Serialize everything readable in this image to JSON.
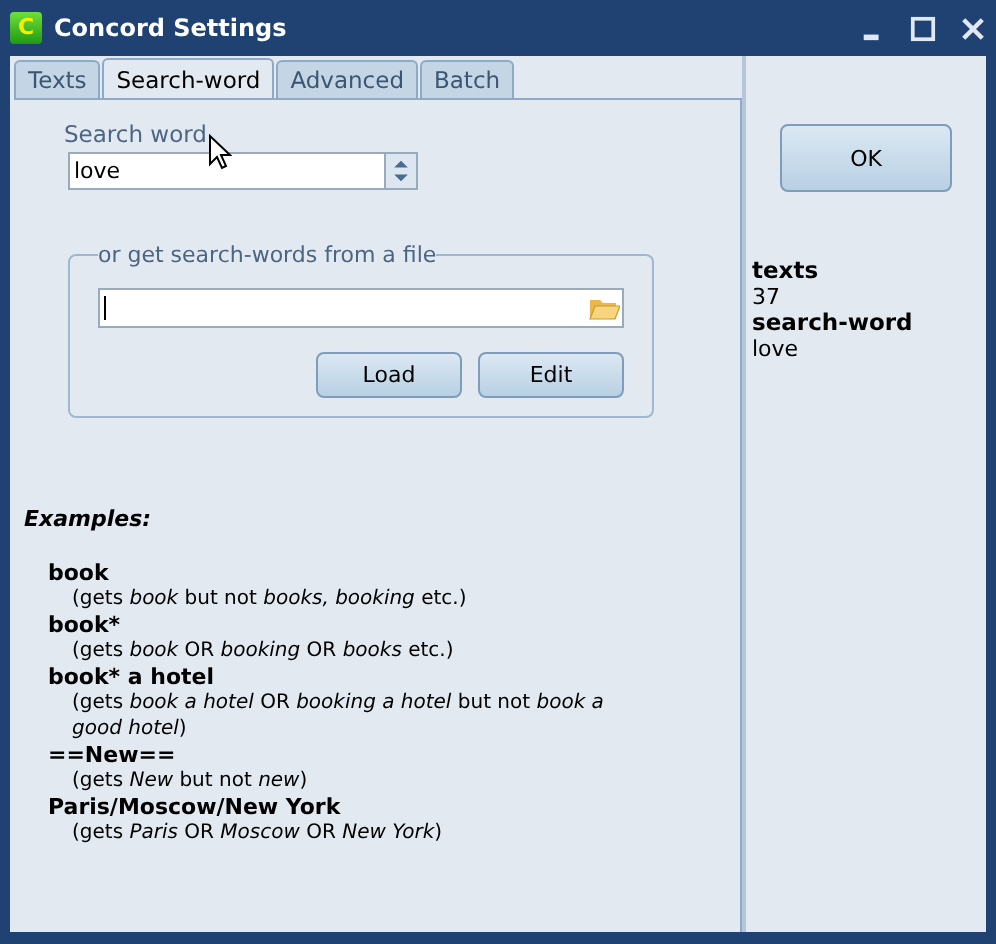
{
  "window": {
    "title": "Concord Settings",
    "logo_letter": "C"
  },
  "tabs": [
    {
      "label": "Texts",
      "selected": false
    },
    {
      "label": "Search-word",
      "selected": true
    },
    {
      "label": "Advanced",
      "selected": false
    },
    {
      "label": "Batch",
      "selected": false
    }
  ],
  "search_word": {
    "label": "Search word",
    "value": "love"
  },
  "file_group": {
    "legend": "or get search-words from a file",
    "buttons": [
      "Load",
      "Edit"
    ]
  },
  "examples": {
    "title": "Examples:",
    "items": [
      {
        "pattern": "book",
        "description": "(gets *book* but not *books, booking* etc.)"
      },
      {
        "pattern": "book*",
        "description": "(gets *book* OR *booking* OR *books* etc.)"
      },
      {
        "pattern": "book* a hotel",
        "description": "(gets *book a hotel* OR *booking a hotel* but not *book a good hotel*)"
      },
      {
        "pattern": "==New==",
        "description": "(gets *New* but not *new*)"
      },
      {
        "pattern": "Paris/Moscow/New York",
        "description": "(gets *Paris* OR *Moscow* OR *New York*)"
      }
    ]
  },
  "ok_button": "OK",
  "summary": [
    {
      "key": "texts",
      "value": "37"
    },
    {
      "key": "search-word",
      "value": "love"
    }
  ]
}
